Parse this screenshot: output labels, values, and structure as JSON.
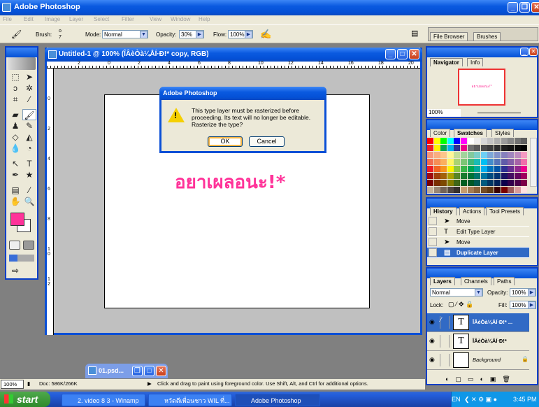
{
  "app": {
    "title": "Adobe Photoshop"
  },
  "menu": [
    "File",
    "Edit",
    "Image",
    "Layer",
    "Select",
    "Filter",
    "View",
    "Window",
    "Help"
  ],
  "options": {
    "brush_label": "Brush:",
    "brush_size": "7",
    "mode_label": "Mode:",
    "mode_value": "Normal",
    "opacity_label": "Opacity:",
    "opacity_value": "30%",
    "flow_label": "Flow:",
    "flow_value": "100%"
  },
  "palette_well": [
    "File Browser",
    "Brushes"
  ],
  "document": {
    "title": "Untitled-1 @ 100% (ÎÂèÒà¼ÅÍ·Ð!* copy, RGB)",
    "ruler_top": [
      "2",
      "0",
      "2",
      "4",
      "6",
      "8",
      "10",
      "12",
      "14",
      "16",
      "18",
      "20"
    ],
    "ruler_left": [
      "0",
      "2",
      "4",
      "6",
      "8",
      "1\n0",
      "1\n2"
    ],
    "canvas_text": "อยาเผลอนะ!*",
    "text_color": "#ff3399"
  },
  "dialog": {
    "title": "Adobe Photoshop",
    "message": "This type layer must be rasterized before proceeding.  Its text will no longer be editable. Rasterize the type?",
    "ok": "OK",
    "cancel": "Cancel",
    "icon": "warning-icon"
  },
  "minimized_doc": {
    "title": "01.psd..."
  },
  "status": {
    "zoom": "100%",
    "doc": "Doc: 586K/266K",
    "hint": "Click and drag to paint using foreground color.  Use Shift, Alt, and Ctrl for additional options."
  },
  "toolbox": {
    "foreground": "#ff3399",
    "background": "#ffffff"
  },
  "navigator": {
    "tabs": [
      "Navigator",
      "Info"
    ],
    "zoom": "100%"
  },
  "swatches": {
    "tabs": [
      "Color",
      "Swatches",
      "Styles"
    ],
    "rows": [
      [
        "#ff0000",
        "#ffff00",
        "#00ff00",
        "#00ffff",
        "#0000ff",
        "#ff00ff",
        "#ffffff",
        "#ebebeb",
        "#d7d7d7",
        "#c3c3c3",
        "#afafaf",
        "#9b9b9b",
        "#878787",
        "#737373",
        "#5f5f5f"
      ],
      [
        "#ed1c24",
        "#fff200",
        "#00a651",
        "#00aeef",
        "#2e3192",
        "#ec008c",
        "#707070",
        "#5a5a5a",
        "#4b4b4b",
        "#3c3c3c",
        "#2d2d2d",
        "#1e1e1e",
        "#141414",
        "#0a0a0a",
        "#000000"
      ],
      [
        "#f7977a",
        "#f9ad81",
        "#fdc68a",
        "#fff799",
        "#c4df9b",
        "#a3d39c",
        "#82ca9d",
        "#7bcdc8",
        "#6dcff6",
        "#7da7d9",
        "#8393ca",
        "#8781bd",
        "#a186be",
        "#bd8cbf",
        "#f49ac1"
      ],
      [
        "#f26c4f",
        "#f68e56",
        "#fbaf5d",
        "#fff568",
        "#acd372",
        "#7cc576",
        "#3bb878",
        "#1abbb4",
        "#00bff3",
        "#438ccb",
        "#5574b9",
        "#605ca8",
        "#855fa8",
        "#a763a8",
        "#f06eaa"
      ],
      [
        "#ed1c24",
        "#f26522",
        "#f7941d",
        "#fff200",
        "#8dc73f",
        "#39b54a",
        "#00a651",
        "#00a99d",
        "#00aeef",
        "#0072bc",
        "#0054a6",
        "#2e3192",
        "#662d91",
        "#92278f",
        "#ec008c"
      ],
      [
        "#9e0b0f",
        "#a0410d",
        "#a36209",
        "#aba000",
        "#598527",
        "#197b30",
        "#007236",
        "#00746b",
        "#0076a3",
        "#004a80",
        "#003471",
        "#1b1464",
        "#440e62",
        "#630460",
        "#9e005d"
      ],
      [
        "#790000",
        "#7b2e00",
        "#7d4900",
        "#827b00",
        "#406618",
        "#005e20",
        "#005826",
        "#005952",
        "#005b7f",
        "#003663",
        "#002157",
        "#0d004c",
        "#32004b",
        "#4b0049",
        "#7b0046"
      ],
      [
        "#c7b299",
        "#998675",
        "#736357",
        "#534741",
        "#37302d",
        "#c69c6d",
        "#a67c52",
        "#8c6239",
        "#754c24",
        "#603913",
        "#3b0000",
        "#790000",
        "#9e5a5a",
        "#d99c9c",
        "#ffe0e0"
      ]
    ]
  },
  "history": {
    "tabs": [
      "History",
      "Actions",
      "Tool Presets"
    ],
    "items": [
      {
        "label": "Move",
        "icon": "move-icon"
      },
      {
        "label": "Edit Type Layer",
        "icon": "type-icon"
      },
      {
        "label": "Move",
        "icon": "move-icon"
      },
      {
        "label": "Duplicate Layer",
        "icon": "layer-icon",
        "selected": true
      }
    ]
  },
  "layers": {
    "tabs": [
      "Layers",
      "Channels",
      "Paths"
    ],
    "blend": "Normal",
    "opacity_label": "Opacity:",
    "opacity": "100%",
    "lock_label": "Lock:",
    "fill_label": "Fill:",
    "fill": "100%",
    "items": [
      {
        "name": "ÎÂèÒà¼ÅÍ·Ð!* ...",
        "thumb": "T",
        "selected": true
      },
      {
        "name": "ÎÂèÒà¼ÅÍ·Ð!*",
        "thumb": "T"
      },
      {
        "name": "Background",
        "thumb": "",
        "locked": true
      }
    ]
  },
  "taskbar": {
    "start": "start",
    "tasks": [
      "2. video 8 3 - Winamp",
      "หวัดดีเพื่อนชาว WIL ที่...",
      "Adobe Photoshop"
    ],
    "lang": "EN",
    "clock": "3:45 PM"
  }
}
